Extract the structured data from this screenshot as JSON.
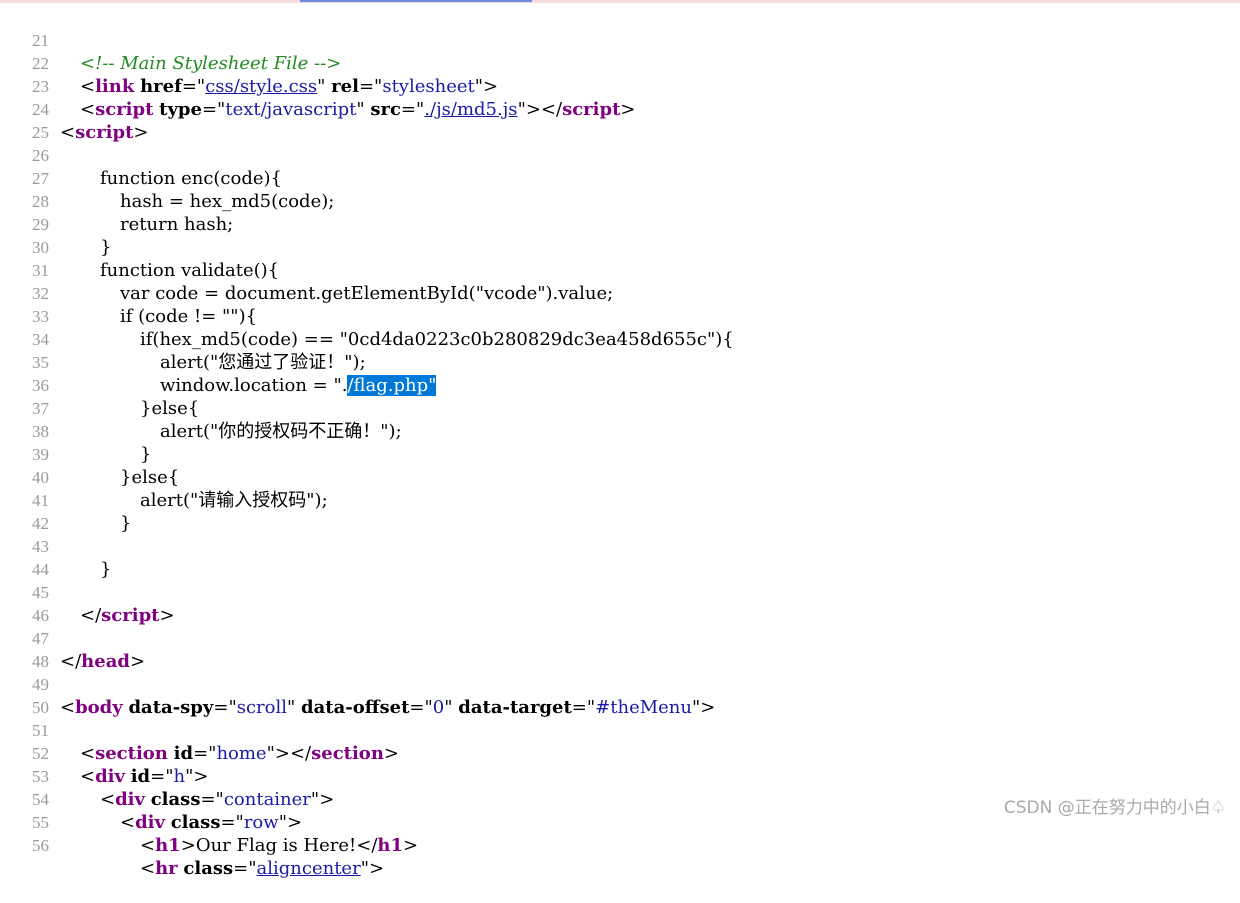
{
  "colors": {
    "tag": "#800080",
    "attr_value": "#1a1aa6",
    "comment": "#228b22",
    "line_number": "#9a9a9a",
    "selection_bg": "#0078d7",
    "text": "#000000"
  },
  "source": {
    "l21": {
      "num": "21",
      "comment": "<!-- Main Stylesheet File -->"
    },
    "l22": {
      "num": "22",
      "open": "<",
      "tag": "link",
      "a1": "href",
      "eq1": "=\"",
      "v1": "css/style.css",
      "q1": "\"",
      "a2": "rel",
      "eq2": "=\"",
      "v2": "stylesheet",
      "close": "\">"
    },
    "l23": {
      "num": "23",
      "open": "<",
      "tag": "script",
      "a1": "type",
      "eq1": "=\"",
      "v1": "text/javascript",
      "q1": "\"",
      "a2": "src",
      "eq2": "=\"",
      "v2": "./js/md5.js",
      "close": "\"></",
      "tag2": "script",
      "close2": ">"
    },
    "l24": {
      "num": "24",
      "open": "<",
      "tag": "script",
      "close": ">"
    },
    "l25": {
      "num": "25"
    },
    "l26": {
      "num": "26",
      "text": "function enc(code){"
    },
    "l27": {
      "num": "27",
      "text": "hash = hex_md5(code);"
    },
    "l28": {
      "num": "28",
      "text": "return hash;"
    },
    "l29": {
      "num": "29",
      "text": "}"
    },
    "l30": {
      "num": "30",
      "text": "function validate(){"
    },
    "l31": {
      "num": "31",
      "text": "var code = document.getElementById(\"vcode\").value;"
    },
    "l32": {
      "num": "32",
      "text": "if (code != \"\"){"
    },
    "l33": {
      "num": "33",
      "text": "if(hex_md5(code) == \"0cd4da0223c0b280829dc3ea458d655c\"){"
    },
    "l34": {
      "num": "34",
      "text": "alert(\"您通过了验证！\");"
    },
    "l35": {
      "num": "35",
      "before": "window.location = \".",
      "selected": "/flag.php\""
    },
    "l36": {
      "num": "36",
      "text": "}else{"
    },
    "l37": {
      "num": "37",
      "text": "alert(\"你的授权码不正确！\");"
    },
    "l38": {
      "num": "38",
      "text": "}"
    },
    "l39": {
      "num": "39",
      "text": "}else{"
    },
    "l40": {
      "num": "40",
      "text": "alert(\"请输入授权码\");"
    },
    "l41": {
      "num": "41",
      "text": "}"
    },
    "l42": {
      "num": "42"
    },
    "l43": {
      "num": "43",
      "text": "}"
    },
    "l44": {
      "num": "44"
    },
    "l45": {
      "num": "45",
      "open": "</",
      "tag": "script",
      "close": ">"
    },
    "l46": {
      "num": "46"
    },
    "l47": {
      "num": "47",
      "open": "</",
      "tag": "head",
      "close": ">"
    },
    "l48": {
      "num": "48"
    },
    "l49": {
      "num": "49",
      "open": "<",
      "tag": "body",
      "a1": "data-spy",
      "eq1": "=\"",
      "v1": "scroll",
      "q1": "\"",
      "a2": "data-offset",
      "eq2": "=\"",
      "v2": "0",
      "q2": "\"",
      "a3": "data-target",
      "eq3": "=\"",
      "v3": "#theMenu",
      "close": "\">"
    },
    "l50": {
      "num": "50"
    },
    "l51": {
      "num": "51",
      "open": "<",
      "tag": "section",
      "a1": "id",
      "eq1": "=\"",
      "v1": "home",
      "close": "\"></",
      "tag2": "section",
      "close2": ">"
    },
    "l52": {
      "num": "52",
      "open": "<",
      "tag": "div",
      "a1": "id",
      "eq1": "=\"",
      "v1": "h",
      "close": "\">"
    },
    "l53": {
      "num": "53",
      "open": "<",
      "tag": "div",
      "a1": "class",
      "eq1": "=\"",
      "v1": "container",
      "close": "\">"
    },
    "l54": {
      "num": "54",
      "open": "<",
      "tag": "div",
      "a1": "class",
      "eq1": "=\"",
      "v1": "row",
      "close": "\">"
    },
    "l55": {
      "num": "55",
      "open": "<",
      "tag": "h1",
      "mid": ">",
      "text": "Our Flag is Here!",
      "open2": "</",
      "tag2": "h1",
      "close2": ">"
    },
    "l56": {
      "num": "56",
      "open": "<",
      "tag": "hr",
      "a1": "class",
      "eq1": "=\"",
      "v1": "aligncenter",
      "close": "\">"
    }
  },
  "watermark": "CSDN @正在努力中的小白♤"
}
